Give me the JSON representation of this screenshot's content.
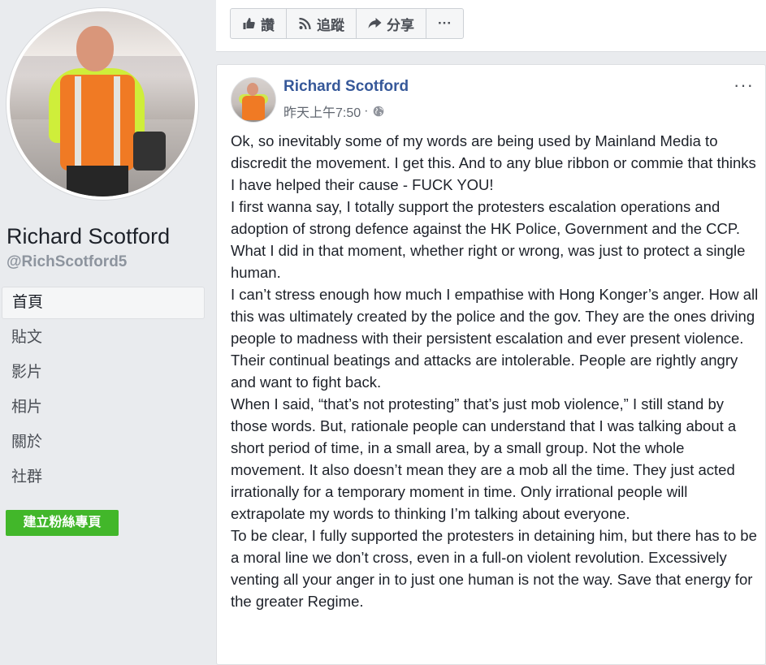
{
  "sidebar": {
    "page_name": "Richard Scotford",
    "handle": "@RichScotford5",
    "nav_items": [
      {
        "label": "首頁",
        "active": true
      },
      {
        "label": "貼文",
        "active": false
      },
      {
        "label": "影片",
        "active": false
      },
      {
        "label": "相片",
        "active": false
      },
      {
        "label": "關於",
        "active": false
      },
      {
        "label": "社群",
        "active": false
      }
    ],
    "create_page_button": "建立粉絲專頁"
  },
  "action_bar": {
    "like_label": "讚",
    "follow_label": "追蹤",
    "share_label": "分享",
    "more_label": "···"
  },
  "post": {
    "author": "Richard Scotford",
    "timestamp": "昨天上午7:50",
    "audience_icon": "globe-icon",
    "more_label": "···",
    "paragraphs": [
      "Ok, so inevitably some of my words are being used by Mainland Media to discredit the movement. I get this. And to any blue ribbon or commie that thinks I have helped their cause - FUCK YOU!",
      "I first wanna say, I totally support the protesters escalation operations and adoption of strong defence against the HK Police, Government and the CCP.",
      "What I did in that moment, whether right or wrong, was just to protect a single human.",
      "I can’t stress enough how much I empathise with Hong Konger’s anger. How all this was ultimately created by the police and the gov. They are the ones driving people to madness with their persistent escalation and ever present violence. Their continual beatings and attacks are intolerable. People are rightly angry and want to fight back.",
      "When I said, “that’s not protesting” that’s just mob violence,” I still stand by those words. But, rationale people can understand that I was talking about a short period of time, in a small area, by a small group. Not the whole movement. It also doesn’t mean they are a mob all the time. They just acted irrationally for a temporary moment in time. Only irrational people will extrapolate my words to thinking I’m talking about everyone.",
      "To be clear, I fully supported the protesters in detaining him, but there has to be a moral line we don’t cross, even in a full-on violent revolution. Excessively venting all your anger in to just one human is not the way. Save that energy for the greater Regime."
    ]
  },
  "colors": {
    "background": "#e9ebee",
    "link_blue": "#365899",
    "green_button": "#42b72a"
  }
}
